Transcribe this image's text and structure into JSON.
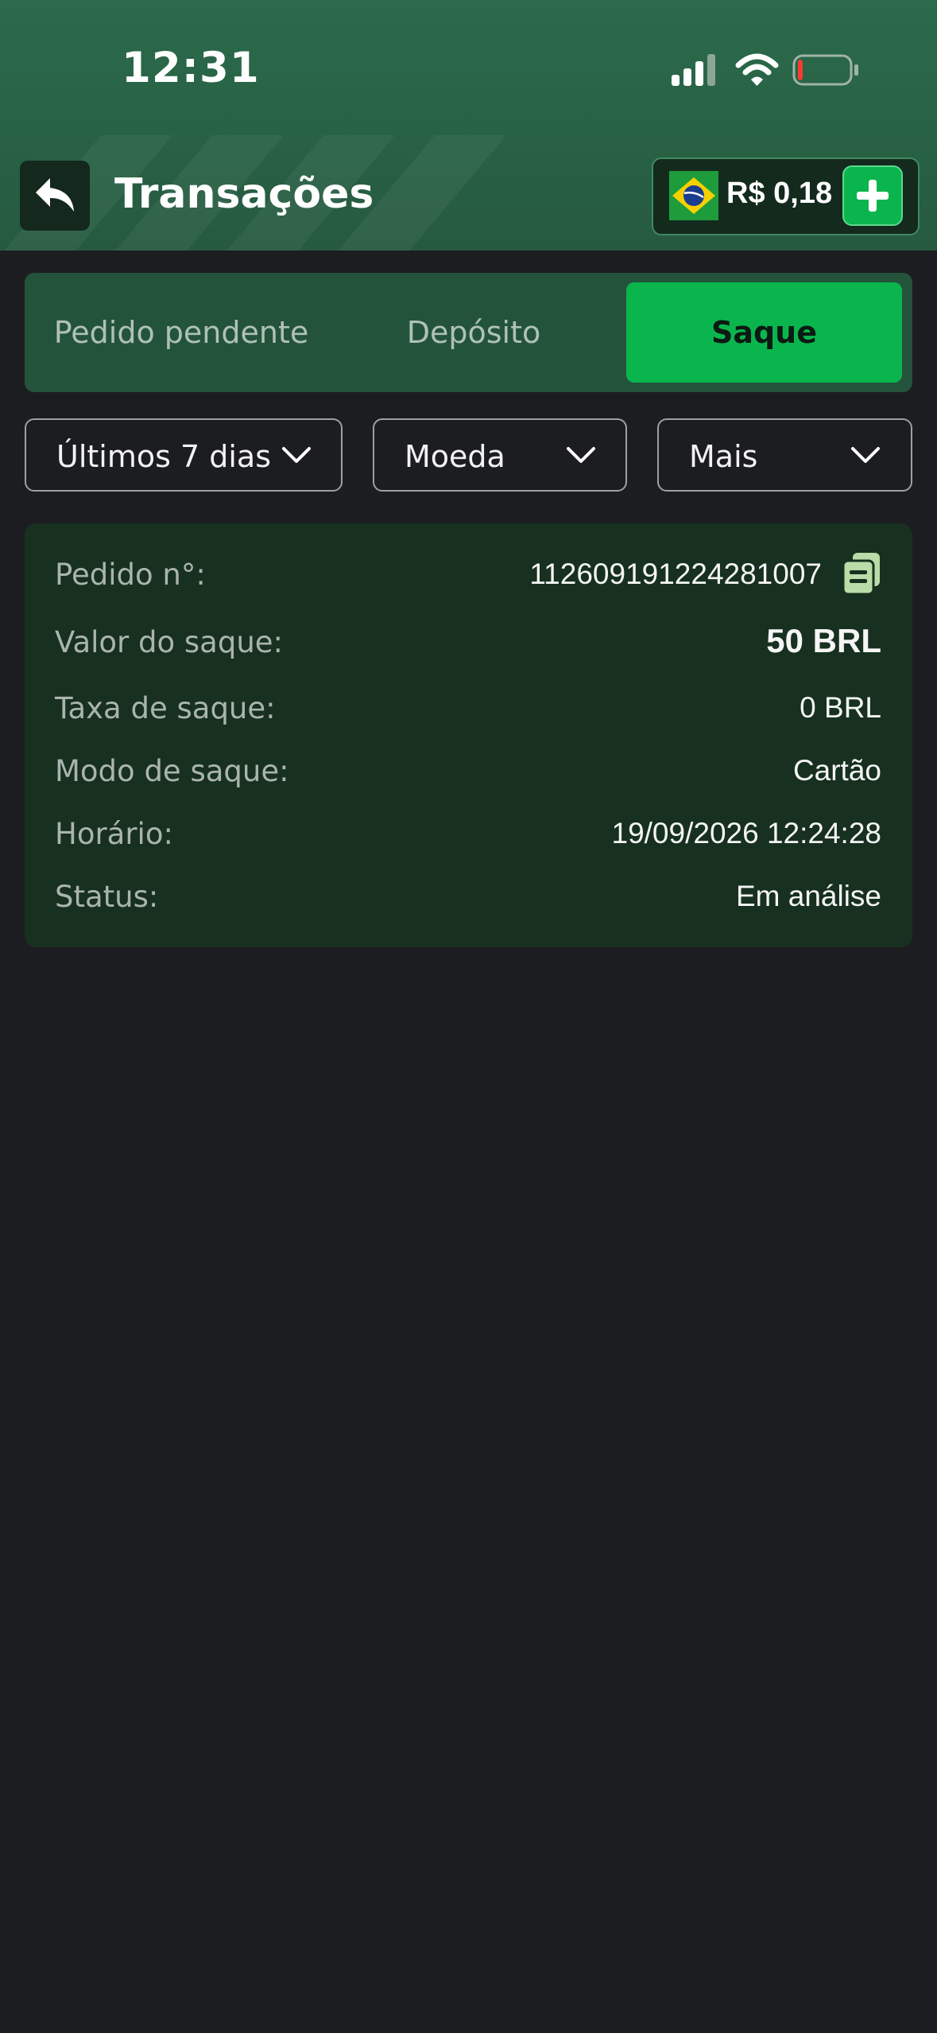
{
  "status_bar": {
    "time": "12:31",
    "battery_level": 0.08,
    "battery_color": "#ff3b30"
  },
  "header": {
    "title": "Transações",
    "back_icon": "back-arrow-icon",
    "balance": "R$ 0,18",
    "flag_icon": "brazil-flag-icon",
    "add_icon": "plus-icon"
  },
  "tabs": [
    {
      "label": "Pedido pendente",
      "active": false
    },
    {
      "label": "Depósito",
      "active": false
    },
    {
      "label": "Saque",
      "active": true
    }
  ],
  "filters": [
    {
      "label": "Últimos 7 dias"
    },
    {
      "label": "Moeda"
    },
    {
      "label": "Mais"
    }
  ],
  "transaction": {
    "order_label": "Pedido n°:",
    "order_value": "112609191224281007",
    "amount_label": "Valor do saque:",
    "amount_value": "50 BRL",
    "fee_label": "Taxa de saque:",
    "fee_value": "0 BRL",
    "mode_label": "Modo de saque:",
    "mode_value": "Cartão",
    "time_label": "Horário:",
    "time_value": "19/09/2026 12:24:28",
    "status_label": "Status:",
    "status_value": "Em análise"
  },
  "colors": {
    "accent": "#0ab54e",
    "header_bg": "#2b6a4b",
    "card_bg": "#17301f",
    "page_bg": "#1c1d21"
  }
}
